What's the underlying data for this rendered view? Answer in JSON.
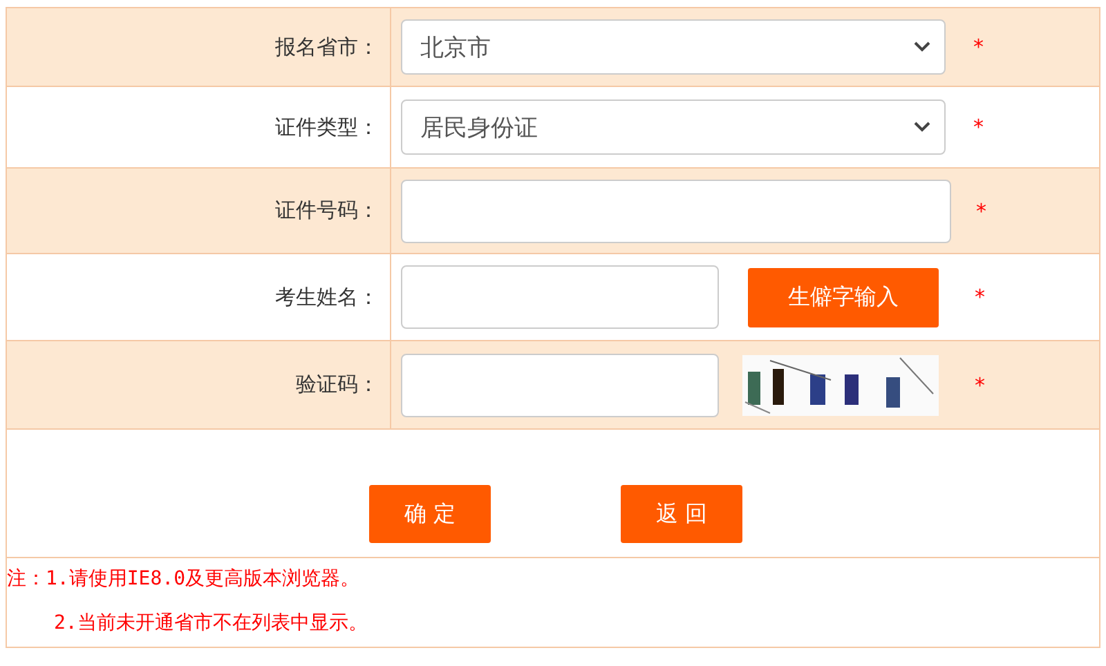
{
  "rows": [
    {
      "label": "报名省市：",
      "kind": "select",
      "value": "北京市",
      "required": true,
      "shaded": true
    },
    {
      "label": "证件类型：",
      "kind": "select",
      "value": "居民身份证",
      "required": true,
      "shaded": false
    },
    {
      "label": "证件号码：",
      "kind": "text",
      "required": true,
      "shaded": true
    },
    {
      "label": "考生姓名：",
      "kind": "text_button",
      "button": "生僻字输入",
      "required": true,
      "shaded": false
    },
    {
      "label": "验证码：",
      "kind": "captcha",
      "required": true,
      "shaded": true
    }
  ],
  "required_mark": "*",
  "buttons": [
    "确 定",
    "返 回"
  ],
  "notes": [
    "注：1.请使用IE8.0及更高版本浏览器。",
    "2.当前未开通省市不在列表中显示。"
  ]
}
